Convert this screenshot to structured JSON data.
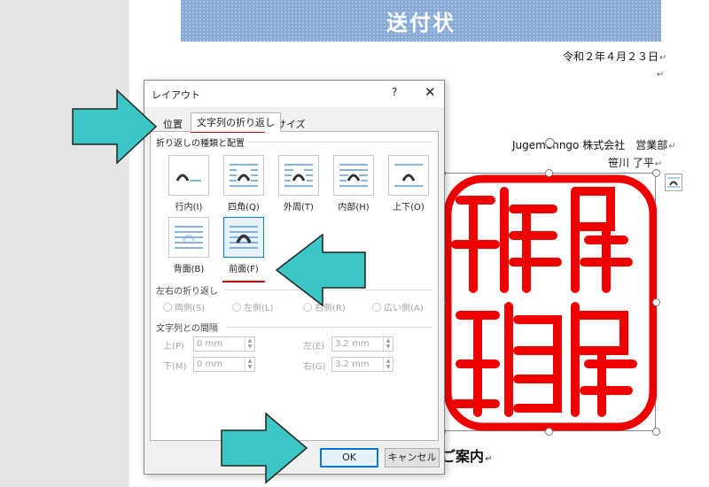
{
  "document": {
    "title": "送付状",
    "date": "令和２年４月２３日",
    "company": "Jugemenngo 株式会社　営業部",
    "person": "笹川 了平",
    "notice": "ご案内",
    "para_mark": "↵"
  },
  "dialog": {
    "title": "レイアウト",
    "help": "?",
    "close": "✕",
    "tabs": [
      {
        "label": "位置"
      },
      {
        "label": "文字列の折り返し"
      },
      {
        "label": "サイズ"
      }
    ],
    "wrap_section_label": "折り返しの種類と配置",
    "wrap_options": [
      {
        "label": "行内(I)"
      },
      {
        "label": "四角(Q)"
      },
      {
        "label": "外周(T)"
      },
      {
        "label": "内部(H)"
      },
      {
        "label": "上下(O)"
      },
      {
        "label": "背面(B)"
      },
      {
        "label": "前面(F)"
      }
    ],
    "lr_wrap_label": "左右の折り返し",
    "lr_options": [
      {
        "label": "両側(S)"
      },
      {
        "label": "左側(L)"
      },
      {
        "label": "右側(R)"
      },
      {
        "label": "広い側(A)"
      }
    ],
    "distance_label": "文字列との間隔",
    "distance": {
      "top_label": "上(P)",
      "top_value": "0 mm",
      "bottom_label": "下(M)",
      "bottom_value": "0 mm",
      "left_label": "左(E)",
      "left_value": "3.2 mm",
      "right_label": "右(G)",
      "right_value": "3.2 mm"
    },
    "ok_label": "OK",
    "cancel_label": "キャンセル"
  },
  "colors": {
    "annotation_arrow": "#3cc6c6",
    "annotation_underline": "#e00000",
    "stamp_red": "#ee0000",
    "title_band": "#87a9d6",
    "selection_blue": "#0078d7"
  }
}
